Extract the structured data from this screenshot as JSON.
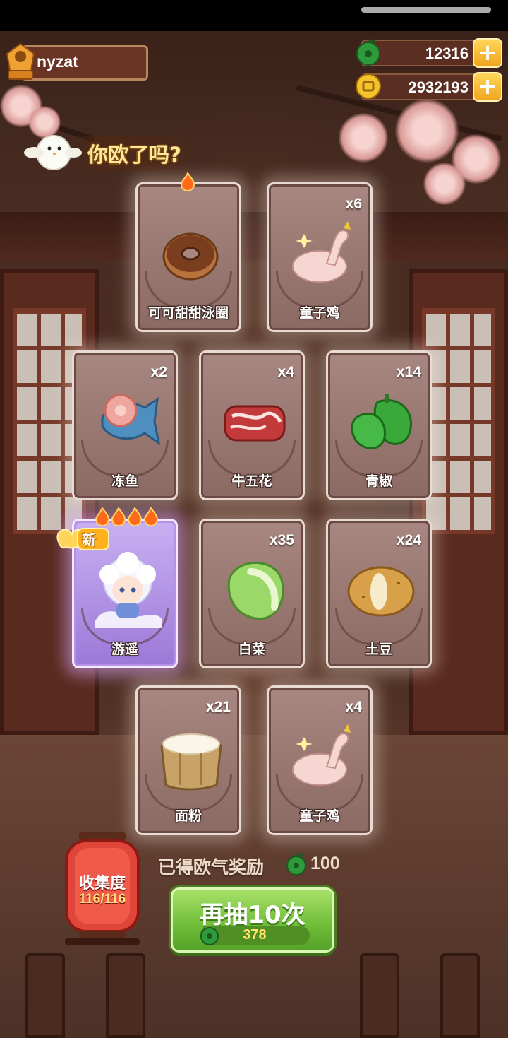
{
  "player": {
    "name": "nyzat"
  },
  "currencies": [
    {
      "icon": "jade-coin-icon",
      "value": "12316",
      "plus": "+"
    },
    {
      "icon": "gold-coin-icon",
      "value": "2932193",
      "plus": "+"
    }
  ],
  "banner": {
    "text": "你欧了吗?"
  },
  "cards": [
    {
      "name": "可可甜甜泳圈",
      "count": "",
      "icon": "donut-icon",
      "flames": 1
    },
    {
      "name": "童子鸡",
      "count": "x6",
      "icon": "chicken-icon",
      "flames": 0
    },
    {
      "name": "冻鱼",
      "count": "x2",
      "icon": "fish-icon",
      "flames": 0
    },
    {
      "name": "牛五花",
      "count": "x4",
      "icon": "beef-icon",
      "flames": 0
    },
    {
      "name": "青椒",
      "count": "x14",
      "icon": "pepper-icon",
      "flames": 0
    },
    {
      "name": "游遥",
      "count": "",
      "icon": "character-portrait",
      "flames": 4,
      "badge": "新"
    },
    {
      "name": "白菜",
      "count": "x35",
      "icon": "cabbage-icon",
      "flames": 0
    },
    {
      "name": "土豆",
      "count": "x24",
      "icon": "potato-icon",
      "flames": 0
    },
    {
      "name": "面粉",
      "count": "x21",
      "icon": "flour-icon",
      "flames": 0
    },
    {
      "name": "童子鸡",
      "count": "x4",
      "icon": "chicken-icon",
      "flames": 0
    }
  ],
  "collection": {
    "label": "收集度",
    "value": "116/116"
  },
  "reward": {
    "label": "已得欧气奖励",
    "value": "100",
    "icon": "jade-coin-icon"
  },
  "draw_button": {
    "label": "再抽10次",
    "cost": "378",
    "cost_icon": "jade-coin-icon"
  },
  "colors": {
    "accent_gold": "#ffd65a",
    "button_green": "#6ebd37",
    "card_brown": "#9c7a74",
    "card_special": "#b592e6"
  }
}
